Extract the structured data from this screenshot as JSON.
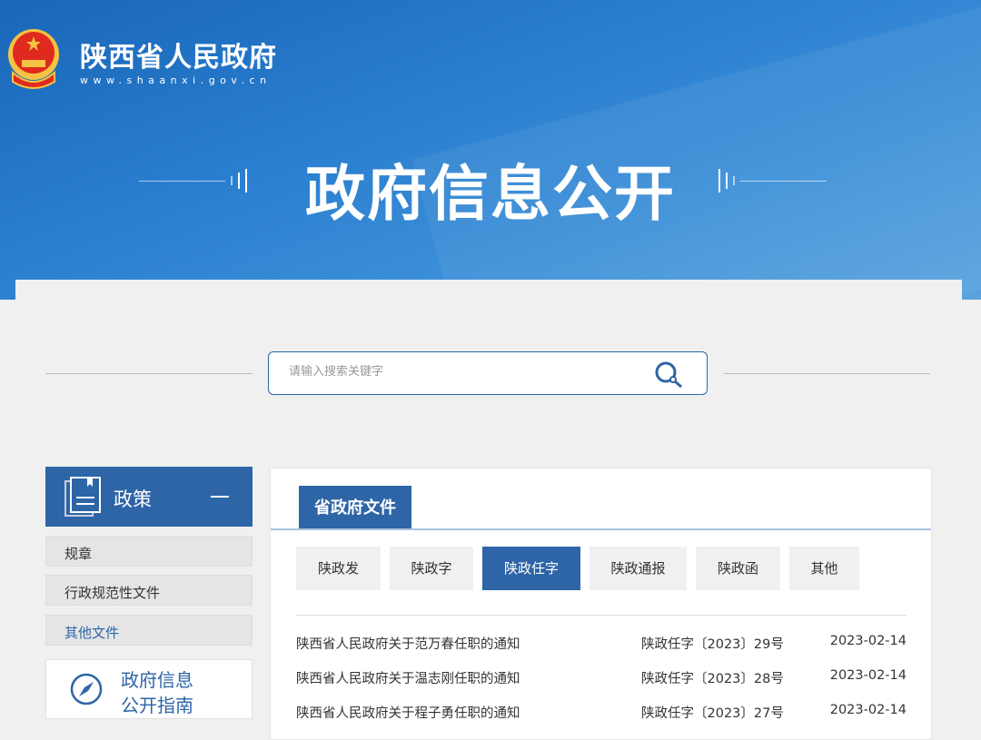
{
  "header": {
    "site_name": "陕西省人民政府",
    "site_url": "www.shaanxi.gov.cn",
    "page_title": "政府信息公开"
  },
  "search": {
    "placeholder": "请输入搜索关键字"
  },
  "sidebar": {
    "head": "政策",
    "items": [
      {
        "label": "规章"
      },
      {
        "label": "行政规范性文件"
      },
      {
        "label": "其他文件"
      }
    ],
    "guide_line1": "政府信息",
    "guide_line2": "公开指南"
  },
  "main": {
    "tab": "省政府文件",
    "subtabs": [
      {
        "label": "陕政发"
      },
      {
        "label": "陕政字"
      },
      {
        "label": "陕政任字"
      },
      {
        "label": "陕政通报"
      },
      {
        "label": "陕政函"
      },
      {
        "label": "其他"
      }
    ],
    "rows": [
      {
        "title": "陕西省人民政府关于范万春任职的通知",
        "num": "陕政任字〔2023〕29号",
        "date": "2023-02-14"
      },
      {
        "title": "陕西省人民政府关于温志刚任职的通知",
        "num": "陕政任字〔2023〕28号",
        "date": "2023-02-14"
      },
      {
        "title": "陕西省人民政府关于程子勇任职的通知",
        "num": "陕政任字〔2023〕27号",
        "date": "2023-02-14"
      }
    ]
  },
  "colors": {
    "primary": "#2d65a6",
    "banner": "#1a66b8"
  }
}
